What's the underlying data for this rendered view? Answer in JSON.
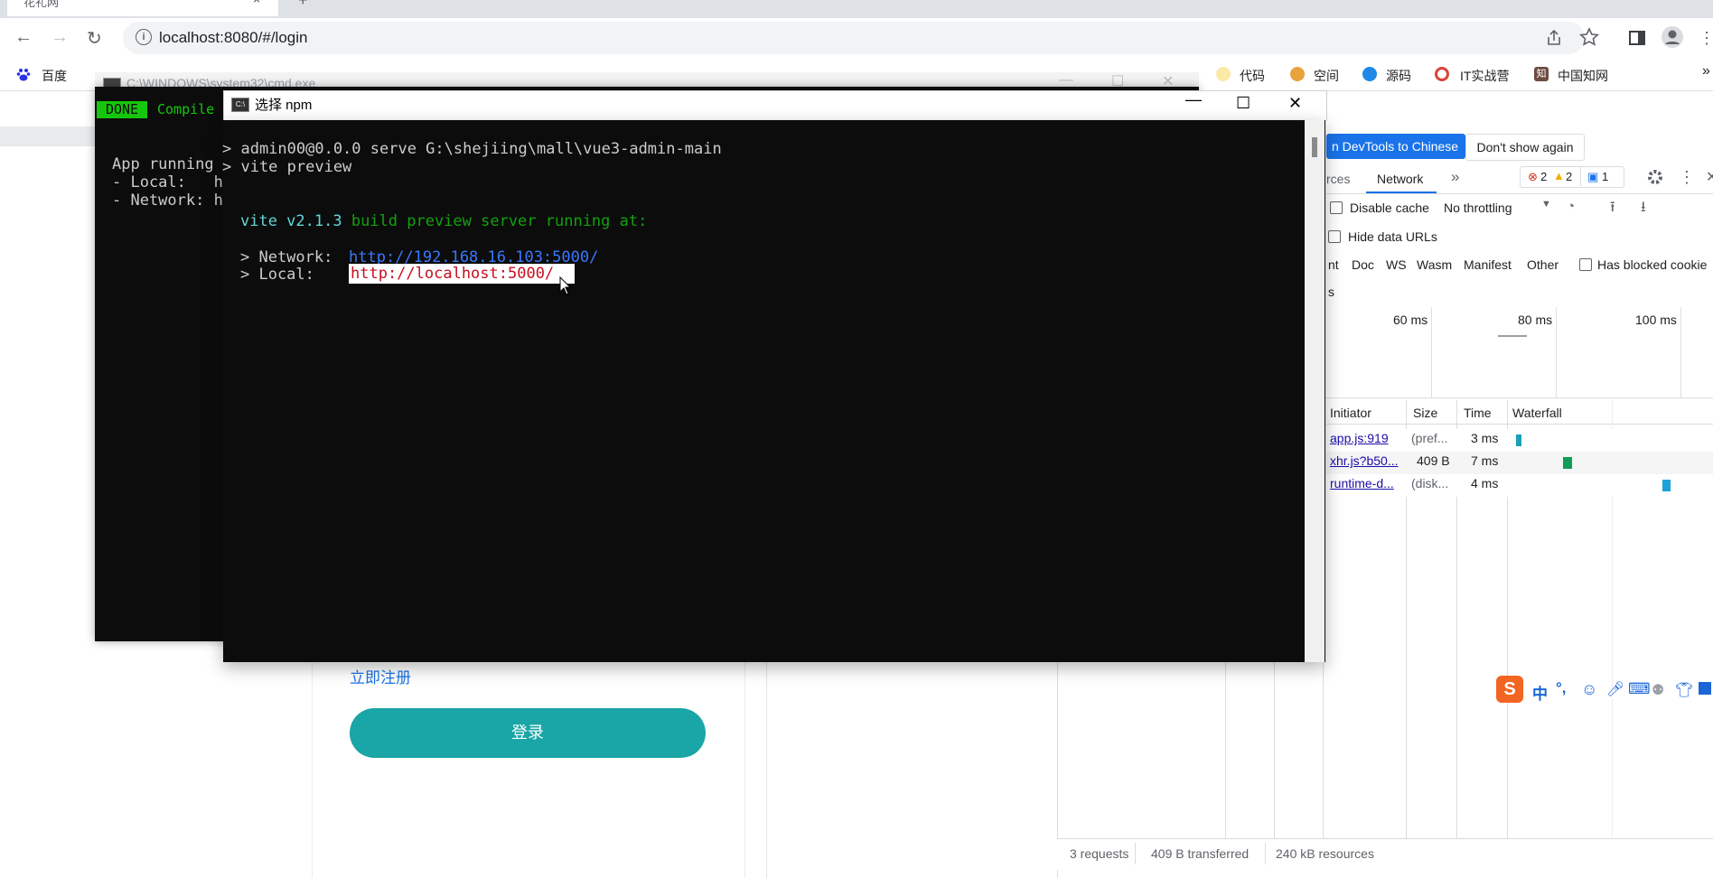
{
  "browser": {
    "tab_title": "花礼网",
    "tab_close": "×",
    "new_tab": "+",
    "url": "localhost:8080/#/login",
    "nav": {
      "back": "←",
      "forward": "→",
      "reload": "↻"
    },
    "bookmarks": [
      {
        "label": "百度",
        "icon": "baidu-icon",
        "color": "#2932e1"
      },
      {
        "label": "代码",
        "icon": "code-icon",
        "color": "#f4b400"
      },
      {
        "label": "空间",
        "icon": "qzone-icon",
        "color": "#e8a33d"
      },
      {
        "label": "源码",
        "icon": "source-icon",
        "color": "#1e88e5"
      },
      {
        "label": "IT实战营",
        "icon": "chrome-icon",
        "color": "#db4437"
      },
      {
        "label": "中国知网",
        "icon": "cnki-icon",
        "color": "#6d4c41"
      }
    ],
    "bookmarks_more": "»"
  },
  "page": {
    "register_link": "立即注册",
    "login_button": "登录"
  },
  "devtools": {
    "translate_button": "n DevTools to Chinese",
    "dismiss_button": "Don't show again",
    "tabs": {
      "prev": "rces",
      "network": "Network",
      "more": "»"
    },
    "badges": {
      "errors": "2",
      "warnings": "2",
      "messages": "1"
    },
    "disable_cache": "Disable cache",
    "throttling": "No throttling",
    "hide_data_urls": "Hide data URLs",
    "filters": [
      "nt",
      "Doc",
      "WS",
      "Wasm",
      "Manifest",
      "Other"
    ],
    "has_blocked_cookies": "Has blocked cookie",
    "filter_cut": "s",
    "timeline_ticks": [
      "60 ms",
      "80 ms",
      "100 ms"
    ],
    "columns": [
      "Initiator",
      "Size",
      "Time",
      "Waterfall"
    ],
    "rows": [
      {
        "initiator": "app.js:919",
        "size": "(pref...",
        "time": "3 ms"
      },
      {
        "initiator": "xhr.js?b50...",
        "size": "409 B",
        "time": "7 ms"
      },
      {
        "initiator": "runtime-d...",
        "size": "(disk...",
        "time": "4 ms"
      }
    ],
    "status": {
      "requests": "3 requests",
      "transferred": "409 B transferred",
      "resources": "240 kB resources"
    }
  },
  "cmd_back": {
    "title": "C:\\WINDOWS\\system32\\cmd.exe",
    "done": "DONE",
    "compiled": "Compile",
    "lines": [
      "App running",
      "- Local:   h",
      "- Network: h"
    ]
  },
  "cmd_front": {
    "title": "选择 npm",
    "lines": {
      "l1": "> admin00@0.0.0 serve G:\\shejiing\\mall\\vue3-admin-main",
      "l2": "> vite preview",
      "vite": "vite v2.1.3",
      "vite_rest": " build preview server running at:",
      "network_label": "> Network:  ",
      "network_url": "http://192.168.16.103:5000/",
      "local_label": "> Local:    ",
      "local_url": "http://localhost:5000/"
    }
  },
  "ime": {
    "logo": "S",
    "lang": "中",
    "punct": "°,",
    "icons": [
      "emoji-icon",
      "mic-icon",
      "keyboard-icon",
      "user-icon",
      "shirt-icon",
      "grid-icon"
    ]
  }
}
